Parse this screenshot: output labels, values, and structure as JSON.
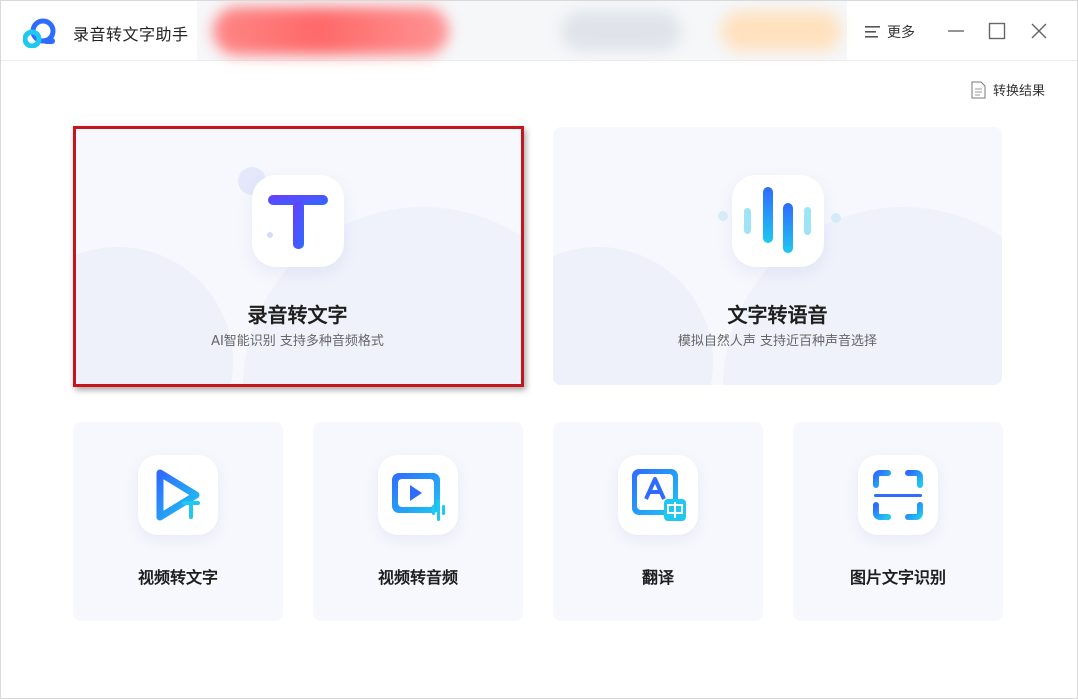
{
  "app": {
    "title": "录音转文字助手"
  },
  "titlebar": {
    "more_label": "更多"
  },
  "toolbar": {
    "result_label": "转换结果"
  },
  "main_cards": [
    {
      "title": "录音转文字",
      "subtitle": "AI智能识别 支持多种音频格式",
      "icon": "text-T-icon",
      "selected": true
    },
    {
      "title": "文字转语音",
      "subtitle": "模拟自然人声 支持近百种声音选择",
      "icon": "sound-wave-icon",
      "selected": false
    }
  ],
  "tool_cards": [
    {
      "title": "视频转文字",
      "icon": "video-to-text-icon"
    },
    {
      "title": "视频转音频",
      "icon": "video-to-audio-icon"
    },
    {
      "title": "翻译",
      "icon": "translate-icon"
    },
    {
      "title": "图片文字识别",
      "icon": "image-ocr-icon"
    }
  ],
  "colors": {
    "accent_blue": "#2f6bff",
    "cyan": "#1ec8f0",
    "selection_red": "#c4161c",
    "card_bg": "#f7f8fd"
  }
}
